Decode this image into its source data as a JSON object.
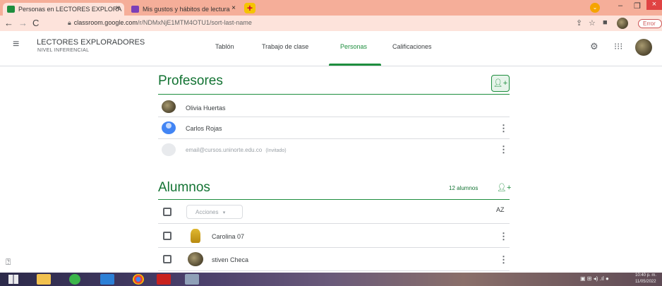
{
  "browser": {
    "tabs": [
      {
        "label": "Personas en LECTORES EXPLORA",
        "close": "×"
      },
      {
        "label": "Mis gustos y hábitos de lectura",
        "close": "×"
      }
    ],
    "new_tab": "+",
    "url_domain": "classroom.google.com",
    "url_path": "/r/NDMxNjE1MTM4OTU1/sort-last-name",
    "error_label": "Error"
  },
  "app": {
    "course_title": "LECTORES EXPLORADORES",
    "course_subtitle": "NIVEL INFERENCIAL",
    "nav_tabs": [
      "Tablón",
      "Trabajo de clase",
      "Personas",
      "Calificaciones"
    ]
  },
  "teachers": {
    "title": "Profesores",
    "rows": [
      {
        "name": "Olivia Huertas"
      },
      {
        "name": "Carlos Rojas"
      },
      {
        "name": "email@cursos.uninorte.edu.co",
        "note": "(Invitado)"
      }
    ]
  },
  "students": {
    "title": "Alumnos",
    "count": "12 alumnos",
    "actions_label": "Acciones",
    "sort_label": "AZ",
    "rows": [
      {
        "name": "Carolina 07"
      },
      {
        "name": "stiven Checa"
      }
    ]
  },
  "taskbar": {
    "time": "10:40 p. m.",
    "date": "11/05/2022"
  },
  "colors": {
    "accent": "#1e8e3e",
    "chrome": "#f5ae99"
  }
}
